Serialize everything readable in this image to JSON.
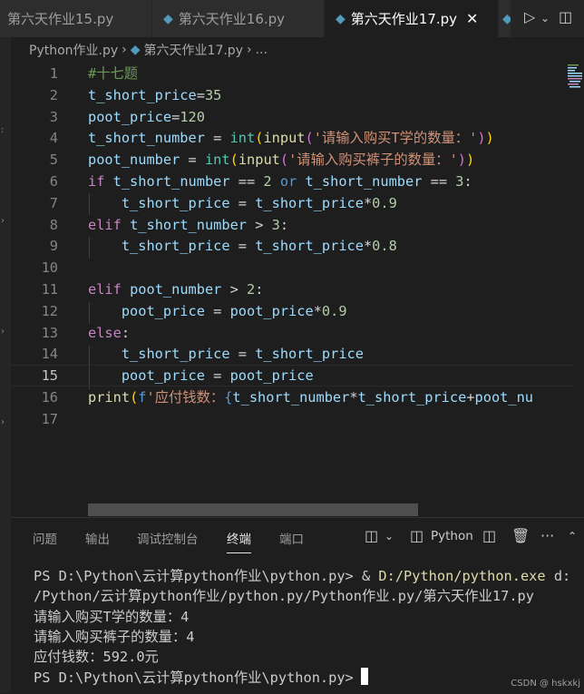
{
  "tabs": [
    {
      "label": "第六天作业15.py",
      "active": false
    },
    {
      "label": "第六天作业16.py",
      "active": false
    },
    {
      "label": "第六天作业17.py",
      "active": true
    }
  ],
  "breadcrumb": [
    "Python作业.py",
    "第六天作业17.py",
    "..."
  ],
  "editor": {
    "current_line": 15,
    "lines": [
      {
        "n": "1",
        "tokens": [
          {
            "t": "#十七题",
            "c": "#6a9955"
          }
        ]
      },
      {
        "n": "2",
        "tokens": [
          {
            "t": "t_short_price",
            "c": "#9cdcfe"
          },
          {
            "t": "=",
            "c": "#d4d4d4"
          },
          {
            "t": "35",
            "c": "#b5cea8"
          }
        ]
      },
      {
        "n": "3",
        "tokens": [
          {
            "t": "poot_price",
            "c": "#9cdcfe"
          },
          {
            "t": "=",
            "c": "#d4d4d4"
          },
          {
            "t": "120",
            "c": "#b5cea8"
          }
        ]
      },
      {
        "n": "4",
        "tokens": [
          {
            "t": "t_short_number",
            "c": "#9cdcfe"
          },
          {
            "t": " = ",
            "c": "#d4d4d4"
          },
          {
            "t": "int",
            "c": "#4ec9b0"
          },
          {
            "t": "(",
            "c": "#ffd700"
          },
          {
            "t": "input",
            "c": "#dcdcaa"
          },
          {
            "t": "(",
            "c": "#da70d6"
          },
          {
            "t": "'请输入购买T学的数量：'",
            "c": "#ce9178"
          },
          {
            "t": ")",
            "c": "#da70d6"
          },
          {
            "t": ")",
            "c": "#ffd700"
          }
        ]
      },
      {
        "n": "5",
        "tokens": [
          {
            "t": "poot_number",
            "c": "#9cdcfe"
          },
          {
            "t": " = ",
            "c": "#d4d4d4"
          },
          {
            "t": "int",
            "c": "#4ec9b0"
          },
          {
            "t": "(",
            "c": "#ffd700"
          },
          {
            "t": "input",
            "c": "#dcdcaa"
          },
          {
            "t": "(",
            "c": "#da70d6"
          },
          {
            "t": "'请输入购买裤子的数量：'",
            "c": "#ce9178"
          },
          {
            "t": ")",
            "c": "#da70d6"
          },
          {
            "t": ")",
            "c": "#ffd700"
          }
        ]
      },
      {
        "n": "6",
        "tokens": [
          {
            "t": "if",
            "c": "#c586c0"
          },
          {
            "t": " ",
            "c": "#d4d4d4"
          },
          {
            "t": "t_short_number",
            "c": "#9cdcfe"
          },
          {
            "t": " == ",
            "c": "#d4d4d4"
          },
          {
            "t": "2",
            "c": "#b5cea8"
          },
          {
            "t": " ",
            "c": "#d4d4d4"
          },
          {
            "t": "or",
            "c": "#569cd6"
          },
          {
            "t": " ",
            "c": "#d4d4d4"
          },
          {
            "t": "t_short_number",
            "c": "#9cdcfe"
          },
          {
            "t": " == ",
            "c": "#d4d4d4"
          },
          {
            "t": "3",
            "c": "#b5cea8"
          },
          {
            "t": ":",
            "c": "#d4d4d4"
          }
        ]
      },
      {
        "n": "7",
        "tokens": [
          {
            "t": "    ",
            "c": "#d4d4d4"
          },
          {
            "t": "t_short_price",
            "c": "#9cdcfe"
          },
          {
            "t": " = ",
            "c": "#d4d4d4"
          },
          {
            "t": "t_short_price",
            "c": "#9cdcfe"
          },
          {
            "t": "*",
            "c": "#d4d4d4"
          },
          {
            "t": "0.9",
            "c": "#b5cea8"
          }
        ]
      },
      {
        "n": "8",
        "tokens": [
          {
            "t": "elif",
            "c": "#c586c0"
          },
          {
            "t": " ",
            "c": "#d4d4d4"
          },
          {
            "t": "t_short_number",
            "c": "#9cdcfe"
          },
          {
            "t": " > ",
            "c": "#d4d4d4"
          },
          {
            "t": "3",
            "c": "#b5cea8"
          },
          {
            "t": ":",
            "c": "#d4d4d4"
          }
        ]
      },
      {
        "n": "9",
        "tokens": [
          {
            "t": "    ",
            "c": "#d4d4d4"
          },
          {
            "t": "t_short_price",
            "c": "#9cdcfe"
          },
          {
            "t": " = ",
            "c": "#d4d4d4"
          },
          {
            "t": "t_short_price",
            "c": "#9cdcfe"
          },
          {
            "t": "*",
            "c": "#d4d4d4"
          },
          {
            "t": "0.8",
            "c": "#b5cea8"
          }
        ]
      },
      {
        "n": "10",
        "tokens": []
      },
      {
        "n": "11",
        "tokens": [
          {
            "t": "elif",
            "c": "#c586c0"
          },
          {
            "t": " ",
            "c": "#d4d4d4"
          },
          {
            "t": "poot_number",
            "c": "#9cdcfe"
          },
          {
            "t": " > ",
            "c": "#d4d4d4"
          },
          {
            "t": "2",
            "c": "#b5cea8"
          },
          {
            "t": ":",
            "c": "#d4d4d4"
          }
        ]
      },
      {
        "n": "12",
        "tokens": [
          {
            "t": "    ",
            "c": "#d4d4d4"
          },
          {
            "t": "poot_price",
            "c": "#9cdcfe"
          },
          {
            "t": " = ",
            "c": "#d4d4d4"
          },
          {
            "t": "poot_price",
            "c": "#9cdcfe"
          },
          {
            "t": "*",
            "c": "#d4d4d4"
          },
          {
            "t": "0.9",
            "c": "#b5cea8"
          }
        ]
      },
      {
        "n": "13",
        "tokens": [
          {
            "t": "else",
            "c": "#c586c0"
          },
          {
            "t": ":",
            "c": "#d4d4d4"
          }
        ]
      },
      {
        "n": "14",
        "tokens": [
          {
            "t": "    ",
            "c": "#d4d4d4"
          },
          {
            "t": "t_short_price",
            "c": "#9cdcfe"
          },
          {
            "t": " = ",
            "c": "#d4d4d4"
          },
          {
            "t": "t_short_price",
            "c": "#9cdcfe"
          }
        ]
      },
      {
        "n": "15",
        "tokens": [
          {
            "t": "    ",
            "c": "#d4d4d4"
          },
          {
            "t": "poot_price",
            "c": "#9cdcfe"
          },
          {
            "t": " = ",
            "c": "#d4d4d4"
          },
          {
            "t": "poot_price",
            "c": "#9cdcfe"
          }
        ]
      },
      {
        "n": "16",
        "tokens": [
          {
            "t": "print",
            "c": "#dcdcaa"
          },
          {
            "t": "(",
            "c": "#ffd700"
          },
          {
            "t": "f",
            "c": "#569cd6"
          },
          {
            "t": "'应付钱数：",
            "c": "#ce9178"
          },
          {
            "t": "{",
            "c": "#569cd6"
          },
          {
            "t": "t_short_number",
            "c": "#9cdcfe"
          },
          {
            "t": "*",
            "c": "#d4d4d4"
          },
          {
            "t": "t_short_price",
            "c": "#9cdcfe"
          },
          {
            "t": "+",
            "c": "#d4d4d4"
          },
          {
            "t": "poot_nu",
            "c": "#9cdcfe"
          }
        ]
      },
      {
        "n": "17",
        "tokens": []
      }
    ]
  },
  "panel": {
    "tabs": [
      "问题",
      "输出",
      "调试控制台",
      "终端",
      "端口"
    ],
    "active_tab": "终端",
    "shell_label": "Python",
    "terminal_lines": [
      [
        {
          "t": "PS D:\\Python\\云计算python作业\\python.py> & ",
          "c": "#cccccc"
        },
        {
          "t": "D:/Python/python.exe",
          "c": "#dcdcaa"
        },
        {
          "t": " d:",
          "c": "#cccccc"
        }
      ],
      [
        {
          "t": "/Python/云计算python作业/python.py/Python作业.py/第六天作业17.py",
          "c": "#cccccc"
        }
      ],
      [
        {
          "t": "请输入购买T学的数量：4",
          "c": "#cccccc"
        }
      ],
      [
        {
          "t": "请输入购买裤子的数量：4",
          "c": "#cccccc"
        }
      ],
      [
        {
          "t": "应付钱数：592.0元",
          "c": "#cccccc"
        }
      ],
      [
        {
          "t": "PS D:\\Python\\云计算python作业\\python.py>",
          "c": "#cccccc"
        }
      ]
    ]
  },
  "watermark": "CSDN @ hskxkj"
}
